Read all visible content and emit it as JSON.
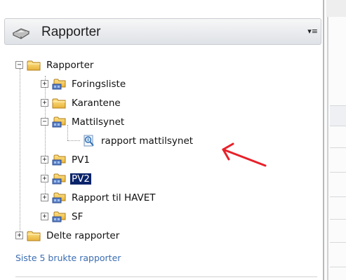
{
  "panel": {
    "title": "Rapporter",
    "menu_glyph": "▾≡",
    "header_icon": "book-icon"
  },
  "tree": {
    "root": {
      "label": "Rapporter",
      "expanded": true,
      "icon": "folder-icon"
    },
    "items": [
      {
        "label": "Foringsliste",
        "expanded": false,
        "icon": "shared-folder-icon"
      },
      {
        "label": "Karantene",
        "expanded": false,
        "icon": "folder-icon"
      },
      {
        "label": "Mattilsynet",
        "expanded": true,
        "icon": "shared-folder-icon",
        "children": [
          {
            "label": "rapport mattilsynet",
            "icon": "report-icon"
          }
        ]
      },
      {
        "label": "PV1",
        "expanded": false,
        "icon": "shared-folder-icon"
      },
      {
        "label": "PV2",
        "expanded": false,
        "icon": "shared-folder-icon",
        "selected": true
      },
      {
        "label": "Rapport til HAVET",
        "expanded": false,
        "icon": "shared-folder-icon"
      },
      {
        "label": "SF",
        "expanded": false,
        "icon": "shared-folder-icon"
      }
    ],
    "shared": {
      "label": "Delte rapporter",
      "expanded": false,
      "icon": "folder-icon"
    }
  },
  "recent_link": "Siste 5 brukte rapporter",
  "colors": {
    "selection_bg": "#0a246a",
    "link": "#3b6db3",
    "annotation": "#e8202a"
  }
}
